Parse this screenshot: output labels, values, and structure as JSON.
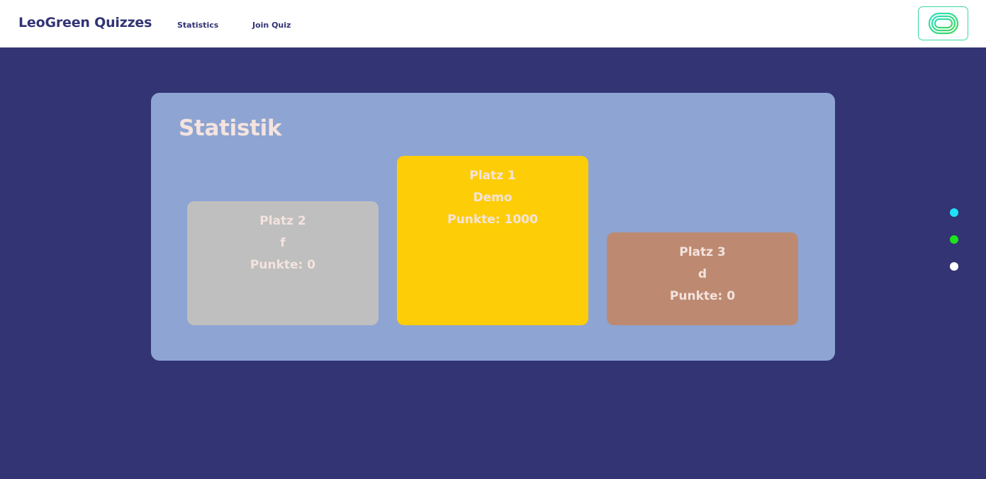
{
  "header": {
    "brand": "LeoGreen Quizzes",
    "nav": [
      {
        "label": "Statistics"
      },
      {
        "label": "Join Quiz"
      }
    ],
    "logo_icon": "leogreen-track-icon"
  },
  "stats": {
    "title": "Statistik",
    "places": [
      {
        "rank_label": "Platz 2",
        "name": "f",
        "points_label": "Punkte: 0",
        "color": "#bfbfbf"
      },
      {
        "rank_label": "Platz 1",
        "name": "Demo",
        "points_label": "Punkte: 1000",
        "color": "#fdce07"
      },
      {
        "rank_label": "Platz 3",
        "name": "d",
        "points_label": "Punkte: 0",
        "color": "#bd8a71"
      }
    ]
  },
  "side_dots": [
    {
      "color": "#1fe3f5"
    },
    {
      "color": "#1ee21e"
    },
    {
      "color": "#ffffff"
    }
  ],
  "colors": {
    "background": "#323474",
    "panel": "#8ea4d2",
    "text_light": "#f4e3de",
    "accent": "#3ad6a6"
  }
}
